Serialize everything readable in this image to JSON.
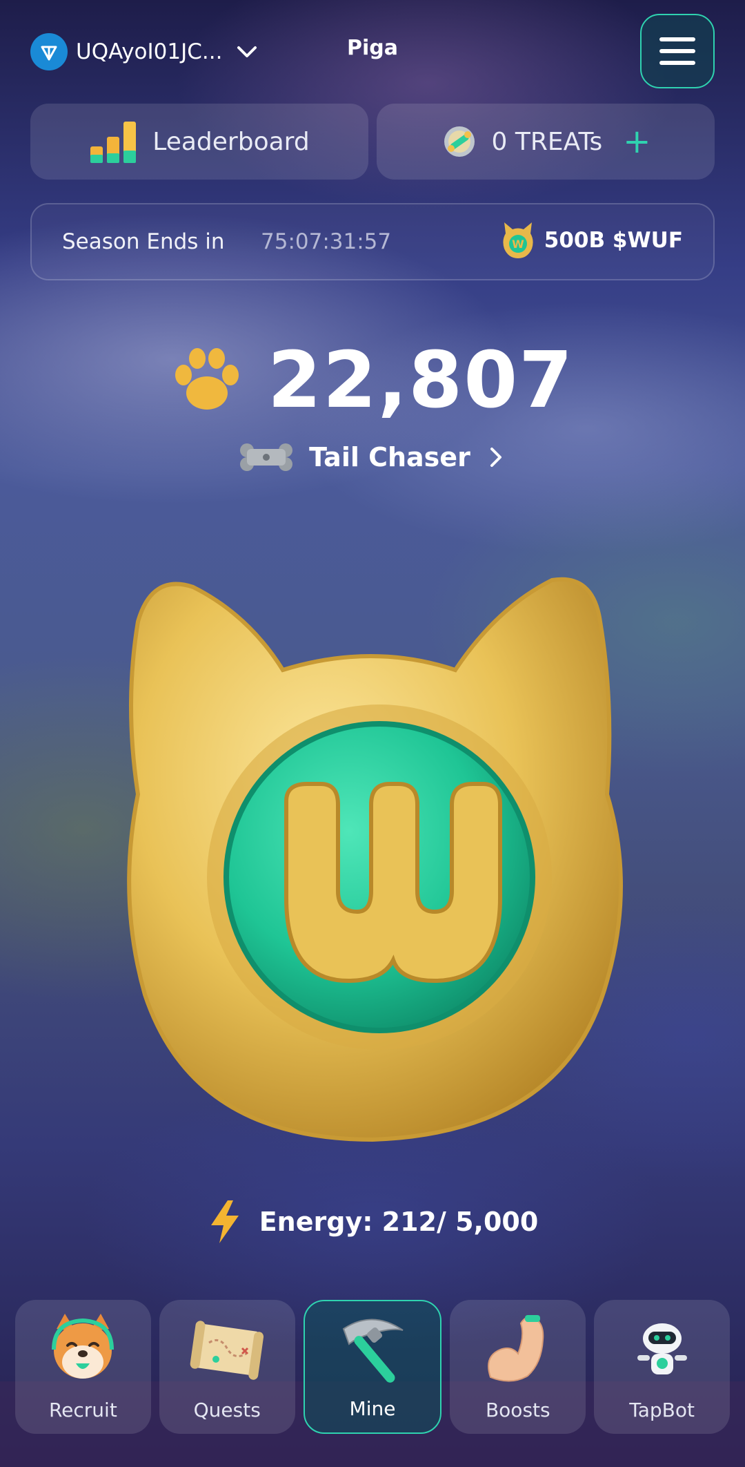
{
  "header": {
    "wallet_address": "UQAyoI01JC...",
    "title": "Piga",
    "icons": {
      "wallet": "ton-icon",
      "dropdown": "chevron-down-icon",
      "menu": "hamburger-menu-icon"
    }
  },
  "top_cards": {
    "leaderboard_label": "Leaderboard",
    "treats_label": "0 TREATs",
    "treats_add": "+"
  },
  "season": {
    "label": "Season Ends in",
    "countdown": "75:07:31:57",
    "prize": "500B $WUF"
  },
  "score": {
    "value": "22,807",
    "rank_label": "Tail Chaser"
  },
  "energy": {
    "label": "Energy: 212/ 5,000",
    "current": 212,
    "max": 5000
  },
  "nav": {
    "items": [
      {
        "label": "Recruit",
        "icon": "shiba-dog-icon",
        "active": false
      },
      {
        "label": "Quests",
        "icon": "scroll-map-icon",
        "active": false
      },
      {
        "label": "Mine",
        "icon": "pickaxe-icon",
        "active": true
      },
      {
        "label": "Boosts",
        "icon": "flexed-arm-icon",
        "active": false
      },
      {
        "label": "TapBot",
        "icon": "robot-icon",
        "active": false
      }
    ]
  },
  "colors": {
    "accent": "#2fd3b0",
    "gold": "#e9c257",
    "coin_green": "#1fc595"
  }
}
